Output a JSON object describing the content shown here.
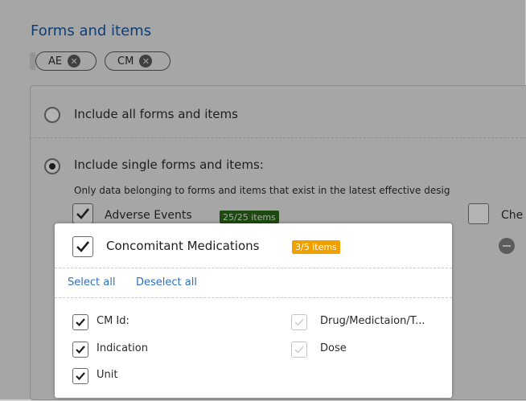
{
  "section": {
    "title": "Forms and items"
  },
  "filter_chips": [
    {
      "label": "AE"
    },
    {
      "label": "CM"
    }
  ],
  "scope": {
    "option_all": "Include all forms and items",
    "option_single": "Include single forms and items:",
    "selected": "single",
    "note": "Only data belonging to forms and items that exist in the latest effective desig"
  },
  "forms": [
    {
      "name": "Adverse Events",
      "badge": "25/25 items",
      "checked": true
    },
    {
      "name": "Che",
      "checked": false
    }
  ],
  "popup": {
    "form_name": "Concomitant Medications",
    "badge": "3/5 items",
    "checked": true,
    "select_all": "Select all",
    "deselect_all": "Deselect all",
    "items": [
      {
        "label": "CM Id:",
        "checked": true
      },
      {
        "label": "Drug/Medictaion/T...",
        "checked": false
      },
      {
        "label": "Indication",
        "checked": true
      },
      {
        "label": "Dose",
        "checked": false
      },
      {
        "label": "Unit",
        "checked": true
      }
    ]
  },
  "colors": {
    "title": "#0d3e78",
    "link": "#2e70c0",
    "badge_green": "#1d4a10",
    "badge_orange": "#f0a000",
    "overlay": "#a6a6a6"
  }
}
